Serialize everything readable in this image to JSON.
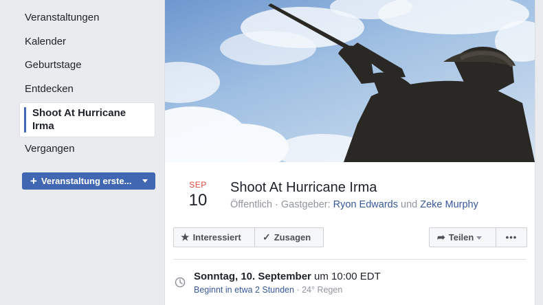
{
  "sidebar": {
    "items": [
      {
        "label": "Veranstaltungen"
      },
      {
        "label": "Kalender"
      },
      {
        "label": "Geburtstage"
      },
      {
        "label": "Entdecken"
      },
      {
        "label": "Shoot At Hurricane Irma"
      },
      {
        "label": "Vergangen"
      }
    ],
    "active_index": 4,
    "create_button": "Veranstaltung erste..."
  },
  "event": {
    "month": "SEP",
    "day": "10",
    "title": "Shoot At Hurricane Irma",
    "privacy": "Öffentlich",
    "host_prefix": "Gastgeber:",
    "host1": "Ryon Edwards",
    "connector": "und",
    "host2": "Zeke Murphy"
  },
  "actions": {
    "interested": "Interessiert",
    "going": "Zusagen",
    "share": "Teilen",
    "more": "•••"
  },
  "details": {
    "day_date": "Sonntag, 10. September",
    "time": "um 10:00 EDT",
    "starts_in": "Beginnt in etwa 2 Stunden",
    "weather": "· 24° Regen"
  },
  "colors": {
    "accent": "#4267b2",
    "link": "#365899",
    "month": "#e2473b"
  }
}
